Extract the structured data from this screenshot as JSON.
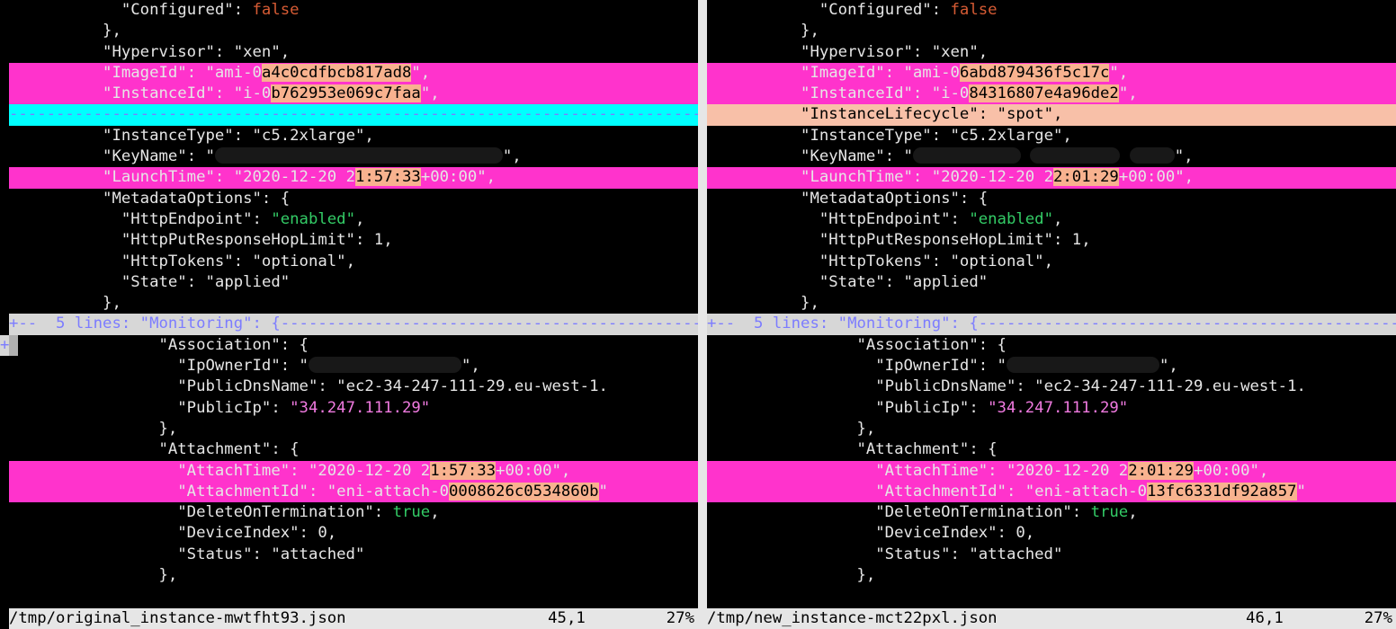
{
  "left": {
    "file": "/tmp/original_instance-mwtfht93.json",
    "cursor": "45,1",
    "percent": "27%",
    "top": {
      "configured_key": "\"Configured\"",
      "configured_val": "false",
      "hypervisor_key": "\"Hypervisor\"",
      "hypervisor_val": "\"xen\"",
      "imageid_key": "\"ImageId\"",
      "imageid_pre": "\"ami-0",
      "imageid_chg": "a4c0cdfbcb817ad8",
      "imageid_post": "\",",
      "instanceid_key": "\"InstanceId\"",
      "instanceid_pre": "\"i-0",
      "instanceid_chg": "b762953e069c7faa",
      "instanceid_post": "\",",
      "instancetype_key": "\"InstanceType\"",
      "instancetype_val": "\"c5.2xlarge\"",
      "keyname_key": "\"KeyName\"",
      "launchtime_key": "\"LaunchTime\"",
      "launchtime_pre": "\"2020-12-20 2",
      "launchtime_chg": "1:57:33",
      "launchtime_post": "+00:00\",",
      "metadata_key": "\"MetadataOptions\"",
      "httpendpoint_key": "\"HttpEndpoint\"",
      "httpendpoint_val": "\"enabled\"",
      "hoplimit_key": "\"HttpPutResponseHopLimit\"",
      "hoplimit_val": "1",
      "tokens_key": "\"HttpTokens\"",
      "tokens_val": "\"optional\"",
      "state_key": "\"State\"",
      "state_val": "\"applied\""
    },
    "fold": {
      "marker": "+-- ",
      "text": " 5 lines: \"Monitoring\": {"
    },
    "bottom": {
      "assoc_key": "\"Association\"",
      "ipowner_key": "\"IpOwnerId\"",
      "dnsname_key": "\"PublicDnsName\"",
      "dnsname_val": "\"ec2-34-247-111-29.eu-west-1.",
      "publicip_key": "\"PublicIp\"",
      "publicip_val": "\"34.247.111.29\"",
      "attach_key": "\"Attachment\"",
      "attachtime_key": "\"AttachTime\"",
      "attachtime_pre": "\"2020-12-20 2",
      "attachtime_chg": "1:57:33",
      "attachtime_post": "+00:00\",",
      "attachid_key": "\"AttachmentId\"",
      "attachid_pre": "\"eni-attach-0",
      "attachid_chg": "0008626c0534860b",
      "attachid_post": "\"",
      "delterm_key": "\"DeleteOnTermination\"",
      "delterm_val": "true",
      "devidx_key": "\"DeviceIndex\"",
      "devidx_val": "0",
      "status_key": "\"Status\"",
      "status_val": "\"attached\""
    }
  },
  "right": {
    "file": "/tmp/new_instance-mct22pxl.json",
    "cursor": "46,1",
    "percent": "27%",
    "top": {
      "configured_key": "\"Configured\"",
      "configured_val": "false",
      "hypervisor_key": "\"Hypervisor\"",
      "hypervisor_val": "\"xen\"",
      "imageid_key": "\"ImageId\"",
      "imageid_pre": "\"ami-0",
      "imageid_chg": "6abd879436f5c17c",
      "imageid_post": "\",",
      "instanceid_key": "\"InstanceId\"",
      "instanceid_pre": "\"i-0",
      "instanceid_chg": "84316807e4a96de2",
      "instanceid_post": "\",",
      "lifecycle_key": "\"InstanceLifecycle\"",
      "lifecycle_val": "\"spot\",",
      "instancetype_key": "\"InstanceType\"",
      "instancetype_val": "\"c5.2xlarge\"",
      "keyname_key": "\"KeyName\"",
      "launchtime_key": "\"LaunchTime\"",
      "launchtime_pre": "\"2020-12-20 2",
      "launchtime_chg": "2:01:29",
      "launchtime_post": "+00:00\",",
      "metadata_key": "\"MetadataOptions\"",
      "httpendpoint_key": "\"HttpEndpoint\"",
      "httpendpoint_val": "\"enabled\"",
      "hoplimit_key": "\"HttpPutResponseHopLimit\"",
      "hoplimit_val": "1",
      "tokens_key": "\"HttpTokens\"",
      "tokens_val": "\"optional\"",
      "state_key": "\"State\"",
      "state_val": "\"applied\""
    },
    "fold": {
      "marker": "+-- ",
      "text": " 5 lines: \"Monitoring\": {"
    },
    "bottom": {
      "assoc_key": "\"Association\"",
      "ipowner_key": "\"IpOwnerId\"",
      "dnsname_key": "\"PublicDnsName\"",
      "dnsname_val": "\"ec2-34-247-111-29.eu-west-1.",
      "publicip_key": "\"PublicIp\"",
      "publicip_val": "\"34.247.111.29\"",
      "attach_key": "\"Attachment\"",
      "attachtime_key": "\"AttachTime\"",
      "attachtime_pre": "\"2020-12-20 2",
      "attachtime_chg": "2:01:29",
      "attachtime_post": "+00:00\",",
      "attachid_key": "\"AttachmentId\"",
      "attachid_pre": "\"eni-attach-0",
      "attachid_chg": "13fc6331df92a857",
      "attachid_post": "\"",
      "delterm_key": "\"DeleteOnTermination\"",
      "delterm_val": "true",
      "devidx_key": "\"DeviceIndex\"",
      "devidx_val": "0",
      "status_key": "\"Status\"",
      "status_val": "\"attached\""
    }
  },
  "foldplus": "+"
}
